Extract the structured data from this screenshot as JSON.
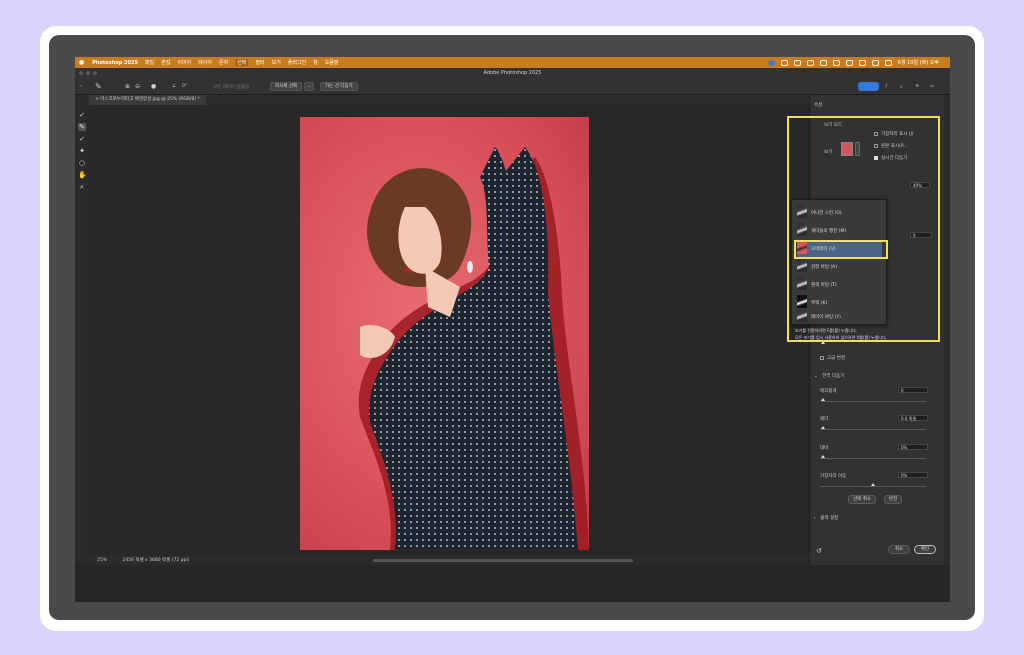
{
  "menubar": {
    "app_name": "Photoshop 2025",
    "items": [
      "파일",
      "편집",
      "이미지",
      "레이어",
      "문자",
      "선택",
      "필터",
      "보기",
      "플러그인",
      "창",
      "도움말"
    ],
    "datetime": "6월 10일 (화) 오후"
  },
  "window": {
    "title": "Adobe Photoshop 2025"
  },
  "options_bar": {
    "brush_size": "0°",
    "sample_label": "모든 레이어 샘플링",
    "select_subject": "피사체 선택",
    "refine_hair": "가는 선 다듬기"
  },
  "document": {
    "tab_title": "마스크로누끼따고 배경합성.jpg @ 25% (RGB/8) *"
  },
  "status_bar": {
    "zoom": "25%",
    "info": "2456 픽셀 x 3680 픽셀 (72 ppi)"
  },
  "properties": {
    "panel_title": "속성",
    "view_mode_title": "보기 모드",
    "view_label": "보기",
    "show_edge": "가장자리 표시 (J)",
    "show_original": "원본 표시(P...",
    "realtime_refine": "실시간 다듬기",
    "opacity_value": "49%",
    "radius_unit": "0",
    "high_quality": "고급 변경",
    "global_refine": "전역 다듬기",
    "smooth_label": "매끄럽게",
    "smooth_value": "0",
    "feather_label": "페더",
    "feather_value": "0.0 픽셀",
    "contrast_label": "대비",
    "contrast_value": "0%",
    "shift_edge_label": "가장자리 이동",
    "shift_edge_value": "0%",
    "clear_selection": "선택 취소",
    "invert": "반전",
    "output_settings": "출력 설정",
    "cancel": "취소",
    "ok": "확인"
  },
  "view_dropdown": {
    "items": [
      {
        "label": "어니언 스킨 (O)"
      },
      {
        "label": "개미들의 행진 (M)"
      },
      {
        "label": "오버레이 (V)"
      },
      {
        "label": "검정 바탕 (A)"
      },
      {
        "label": "흰색 바탕 (T)"
      },
      {
        "label": "흑백 (K)"
      },
      {
        "label": "레이어 바탕 (Y)"
      }
    ],
    "selected": "오버레이 (V)",
    "help_line1": "보기를 전환하려면 F를(를) 누릅니다.",
    "help_line2": "모든 보기를 임시 사용하지 않으려면 X를(를) 누릅니다."
  },
  "colors": {
    "accent": "#2f7be0",
    "highlight": "#f2e05a",
    "menubar": "#c97c1f",
    "backdrop": "#d9d4fb"
  }
}
